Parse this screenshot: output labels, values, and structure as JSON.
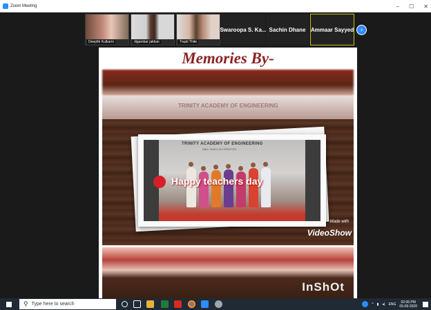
{
  "window": {
    "title": "Zoom Meeting",
    "controls": [
      "–",
      "☐",
      "✕"
    ]
  },
  "participants": [
    {
      "name": "Deepthi Kulkarni",
      "has_video": true
    },
    {
      "name": "digambar jakkan",
      "has_video": true
    },
    {
      "name": "Trupti Thite",
      "has_video": true
    },
    {
      "name": "Swaroopa S. Ka...",
      "has_video": false
    },
    {
      "name": "Sachin Dhane",
      "has_video": false
    },
    {
      "name": "Ammaar Sayyed",
      "has_video": false,
      "active": true
    }
  ],
  "next_icon": "chevron-right-icon",
  "shared_video": {
    "title": "Memories By-",
    "banner": "TRINITY ACADEMY OF ENGINEERING",
    "banner_sub": "NBA / NAAC ACCREDITED",
    "blur_text": "TRINITY ACADEMY OF ENGINEERING",
    "caption": "Happy teachers day",
    "watermark_made": "Made with",
    "watermark_app": "VideoShow",
    "watermark_inshot": "InShOt"
  },
  "taskbar": {
    "search_placeholder": "Type here to search",
    "lang": "ENG",
    "time": "02:06 PM",
    "date": "05-09-2020"
  },
  "colors": {
    "accent": "#2d8cff",
    "title": "#8b2323",
    "taskbar": "#202a35"
  }
}
